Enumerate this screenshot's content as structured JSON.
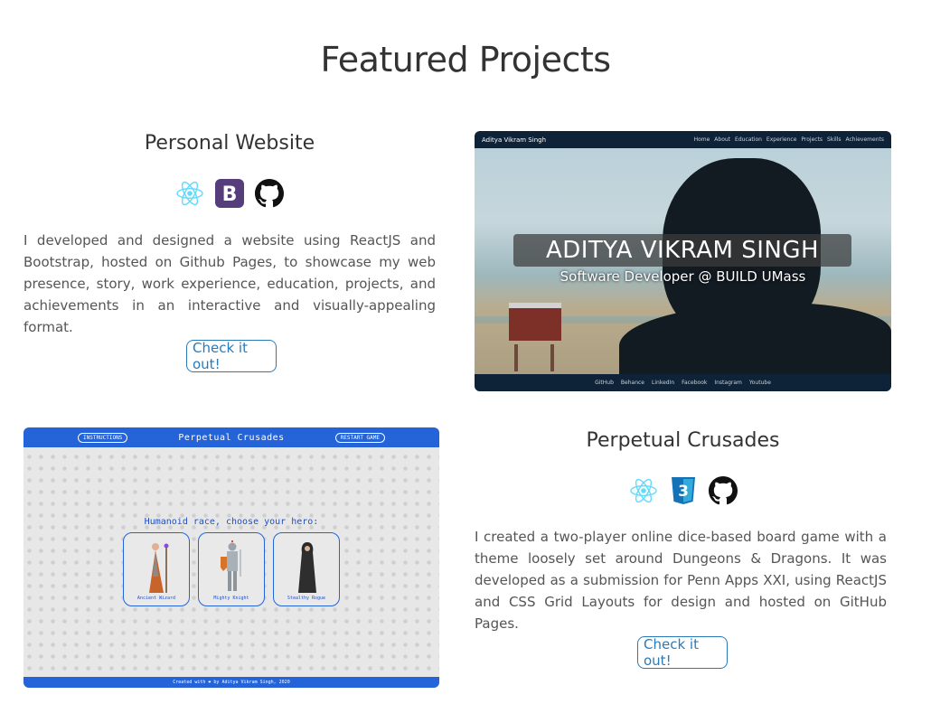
{
  "section": {
    "title": "Featured Projects"
  },
  "projects": [
    {
      "title": "Personal Website",
      "icons": [
        "react-icon",
        "bootstrap-icon",
        "github-icon"
      ],
      "description": "I developed and designed a website using ReactJS and Bootstrap, hosted on Github Pages, to showcase my web presence, story, work experience, education, projects, and achievements in an interactive and visually-appealing format.",
      "button": "Check it out!",
      "screenshot": {
        "brand": "Aditya Vikram Singh",
        "nav": [
          "Home",
          "About",
          "Education",
          "Experience",
          "Projects",
          "Skills",
          "Achievements"
        ],
        "name": "ADITYA VIKRAM SINGH",
        "tagline": "Software Developer @ BUILD UMass",
        "footer": [
          "GitHub",
          "Behance",
          "LinkedIn",
          "Facebook",
          "Instagram",
          "Youtube"
        ]
      }
    },
    {
      "title": "Perpetual Crusades",
      "icons": [
        "react-icon",
        "css3-icon",
        "github-icon"
      ],
      "description": "I created a two-player online dice-based board game with a theme loosely set around Dungeons & Dragons. It was developed as a submission for Penn Apps XXI, using ReactJS and CSS Grid Layouts for design and hosted on GitHub Pages.",
      "button": "Check it out!",
      "screenshot": {
        "left_pill": "INSTRUCTIONS",
        "title": "Perpetual Crusades",
        "right_pill": "RESTART GAME",
        "prompt": "Humanoid race, choose your hero:",
        "heroes": [
          "Ancient Wizard",
          "Mighty Knight",
          "Stealthy Rogue"
        ],
        "footer": "Created with ❤ by Aditya Vikram Singh, 2020"
      }
    }
  ],
  "colors": {
    "accent": "#2a7ab8",
    "react": "#61dafb",
    "bootstrap": "#563d7c",
    "css3": "#1572b6",
    "game_blue": "#2463d8"
  }
}
